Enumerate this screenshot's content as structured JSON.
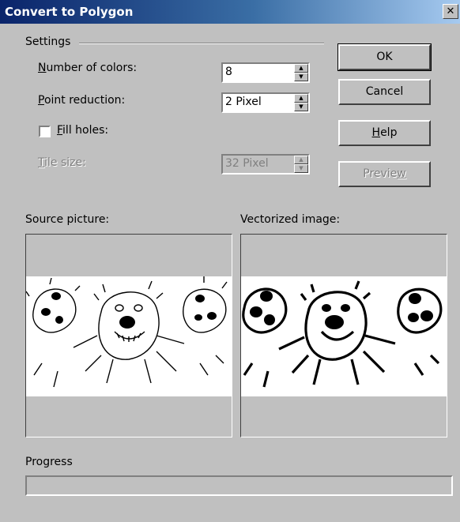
{
  "window": {
    "title": "Convert to Polygon",
    "close_glyph": "✕"
  },
  "settings": {
    "group_label": "Settings",
    "number_of_colors": {
      "label_accel": "N",
      "label_rest": "umber of colors:",
      "value": "8"
    },
    "point_reduction": {
      "label_accel": "P",
      "label_rest": "oint reduction:",
      "value": "2 Pixel"
    },
    "fill_holes": {
      "label_accel": "F",
      "label_rest": "ill holes:",
      "checked": false
    },
    "tile_size": {
      "label_accel": "T",
      "label_rest": "ile size:",
      "value": "32 Pixel",
      "enabled": false
    }
  },
  "buttons": {
    "ok": "OK",
    "cancel": "Cancel",
    "help": {
      "accel": "H",
      "rest": "elp"
    },
    "preview": {
      "before": "Previe",
      "accel": "w",
      "enabled": false
    }
  },
  "source_label": "Source picture:",
  "vectorized_label": "Vectorized image:",
  "progress": {
    "label": "Progress",
    "value": 0
  },
  "icons": {
    "close": "close-icon",
    "spin_up": "spin-up-icon",
    "spin_down": "spin-down-icon"
  }
}
